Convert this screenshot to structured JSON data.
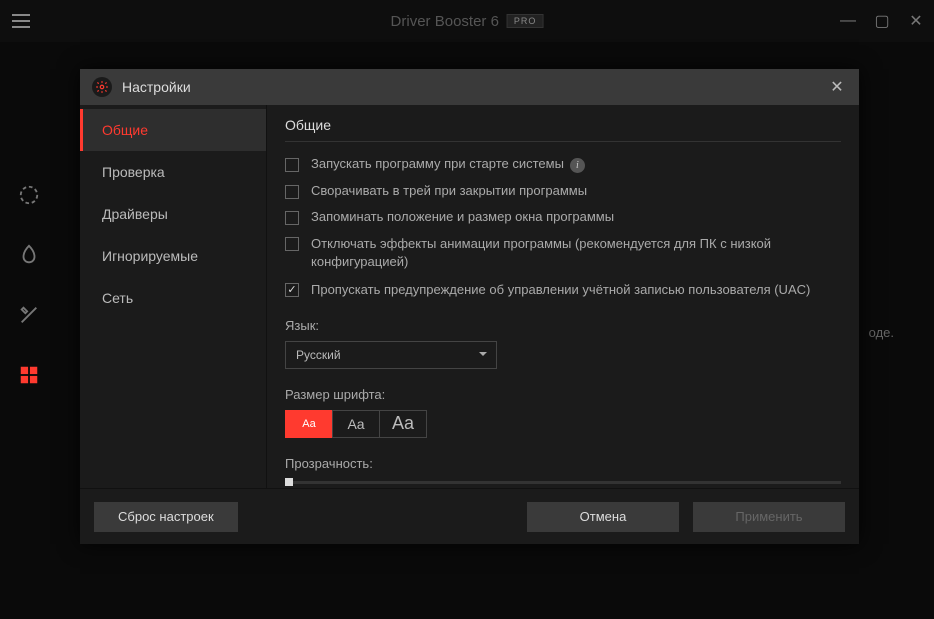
{
  "app": {
    "title": "Driver Booster 6",
    "badge": "PRO"
  },
  "bg_hint_tail": "оде.",
  "dialog": {
    "title": "Настройки",
    "sidebar": {
      "items": [
        {
          "label": "Общие"
        },
        {
          "label": "Проверка"
        },
        {
          "label": "Драйверы"
        },
        {
          "label": "Игнорируемые"
        },
        {
          "label": "Сеть"
        }
      ]
    },
    "content": {
      "heading": "Общие",
      "checks": [
        {
          "label": "Запускать программу при старте системы",
          "checked": false,
          "info": true
        },
        {
          "label": "Сворачивать в трей при закрытии программы",
          "checked": false
        },
        {
          "label": "Запоминать положение и размер окна программы",
          "checked": false
        },
        {
          "label": "Отключать эффекты анимации программы (рекомендуется для ПК с низкой конфигурацией)",
          "checked": false
        },
        {
          "label": "Пропускать предупреждение об управлении учётной записью пользователя (UAC)",
          "checked": true
        }
      ],
      "language_label": "Язык:",
      "language_value": "Русский",
      "fontsize_label": "Размер шрифта:",
      "font_btn_text": "Aa",
      "transparency_label": "Прозрачность:"
    },
    "footer": {
      "reset": "Сброс настроек",
      "cancel": "Отмена",
      "apply": "Применить"
    }
  }
}
